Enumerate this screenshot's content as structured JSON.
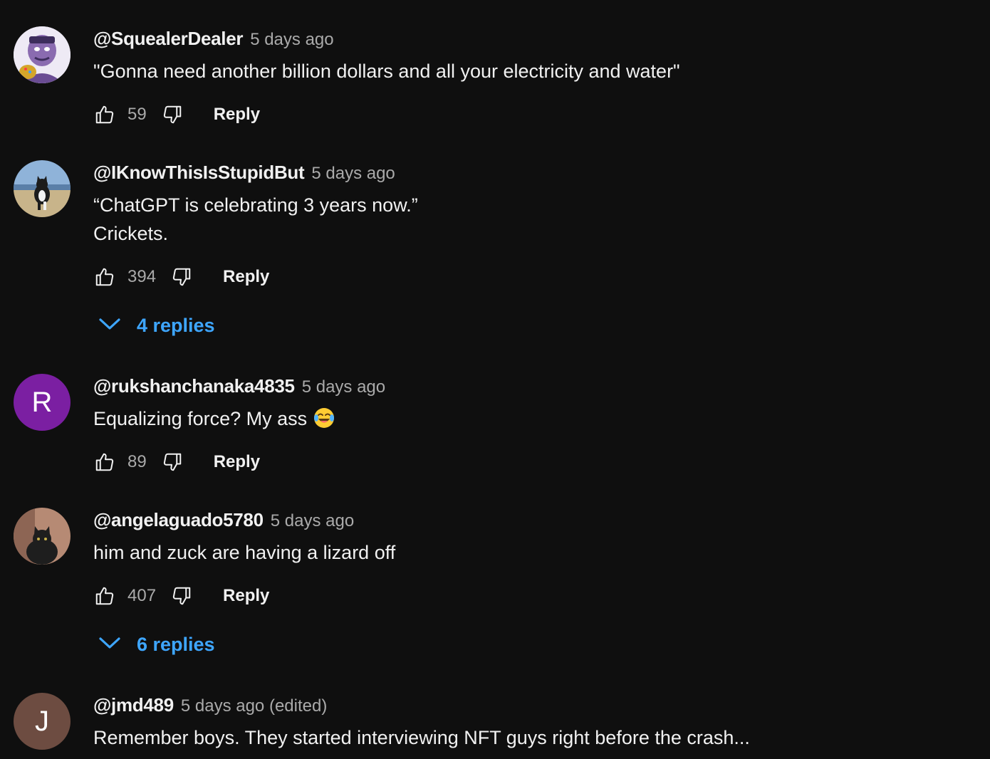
{
  "comments": [
    {
      "author": "@SquealerDealer",
      "timestamp": "5 days ago",
      "lines": [
        "\"Gonna need another billion dollars and all your electricity and water\""
      ],
      "likes": "59",
      "reply_label": "Reply",
      "avatar_icon": "cartoon-character-avatar"
    },
    {
      "author": "@IKnowThisIsStupidBut",
      "timestamp": "5 days ago",
      "lines": [
        "“ChatGPT is celebrating 3 years now.”",
        "Crickets."
      ],
      "likes": "394",
      "reply_label": "Reply",
      "replies": "4 replies",
      "avatar_icon": "cat-on-beach-avatar"
    },
    {
      "author": "@rukshanchanaka4835",
      "timestamp": "5 days ago",
      "lines": [
        "Equalizing force?  My ass"
      ],
      "likes": "89",
      "reply_label": "Reply",
      "avatar_letter": "R",
      "avatar_color": "#7b1fa2"
    },
    {
      "author": "@angelaguado5780",
      "timestamp": "5 days ago",
      "lines": [
        "him and zuck are having a lizard off"
      ],
      "likes": "407",
      "reply_label": "Reply",
      "replies": "6 replies",
      "avatar_icon": "black-cat-avatar"
    },
    {
      "author": "@jmd489",
      "timestamp": "5 days ago (edited)",
      "lines": [
        "Remember boys. They started interviewing NFT guys right before the crash..."
      ],
      "avatar_letter": "J",
      "avatar_color": "#6d4c41"
    }
  ],
  "icons": {
    "like": "thumb-up-icon",
    "dislike": "thumb-down-icon",
    "expand": "chevron-down-icon",
    "emoji": "laughing-tears-emoji"
  },
  "colors": {
    "background": "#0f0f0f",
    "text": "#f1f1f1",
    "secondary_text": "#aaaaaa",
    "link_blue": "#3ea6ff"
  }
}
